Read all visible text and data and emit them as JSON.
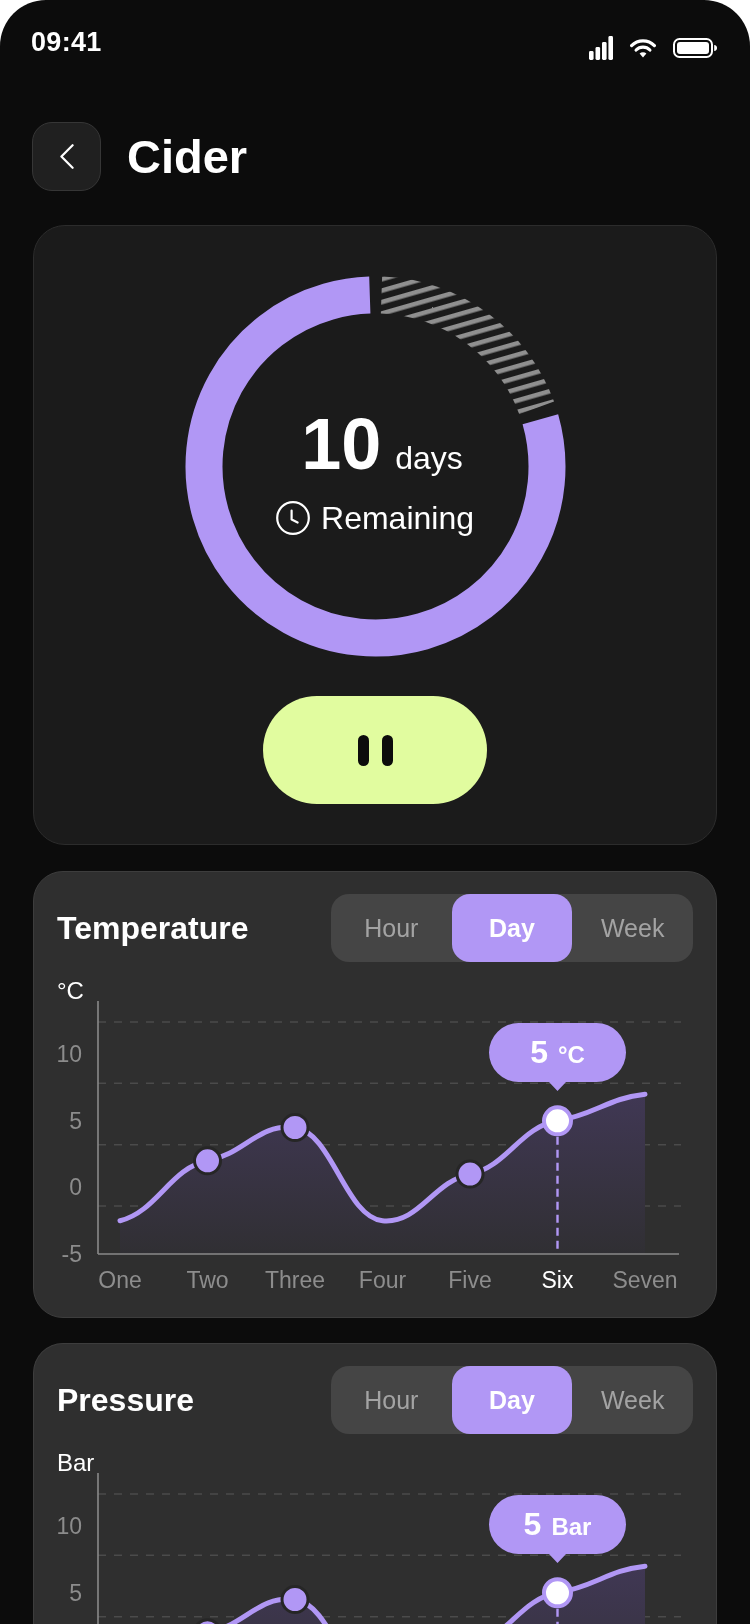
{
  "status_bar": {
    "time": "09:41"
  },
  "header": {
    "title": "Cider"
  },
  "timer": {
    "value": "10",
    "unit": "days",
    "label": "Remaining",
    "level": 0.8
  },
  "charts": [
    {
      "kind": "full",
      "title": "Temperature",
      "tabs": [
        {
          "label": "Hour",
          "selected": false
        },
        {
          "label": "Day",
          "selected": true
        },
        {
          "label": "Week",
          "selected": false
        }
      ],
      "tooltip": {
        "value": "5",
        "unit": "°C"
      },
      "points": [
        {
          "marked": false,
          "selected": false
        },
        {
          "marked": true,
          "selected": false
        },
        {
          "marked": true,
          "selected": false
        },
        {
          "marked": false,
          "selected": false
        },
        {
          "marked": true,
          "selected": false
        },
        {
          "marked": true,
          "selected": true
        },
        {
          "marked": false,
          "selected": false
        }
      ],
      "chart_data": {
        "type": "line",
        "ylabel": "°C",
        "categories": [
          "One",
          "Two",
          "Three",
          "Four",
          "Five",
          "Six",
          "Seven"
        ],
        "series": [
          {
            "color": "#b197f5",
            "values": [
              -2.5,
              2,
              4.5,
              -2.5,
              1,
              5,
              7
            ]
          }
        ],
        "ylim": [
          -5,
          14
        ],
        "yticks": [
          -5,
          0,
          5,
          10
        ],
        "ref_lines": [
          {
            "axis": "x",
            "value": "Six"
          }
        ]
      }
    },
    {
      "kind": "cropped",
      "title": "Pressure",
      "tabs": [
        {
          "label": "Hour",
          "selected": false
        },
        {
          "label": "Day",
          "selected": true
        },
        {
          "label": "Week",
          "selected": false
        }
      ],
      "tooltip": {
        "value": "5",
        "unit": "Bar"
      },
      "axis": {
        "unit": "Bar",
        "ticks": [
          "10",
          "5"
        ]
      }
    }
  ]
}
